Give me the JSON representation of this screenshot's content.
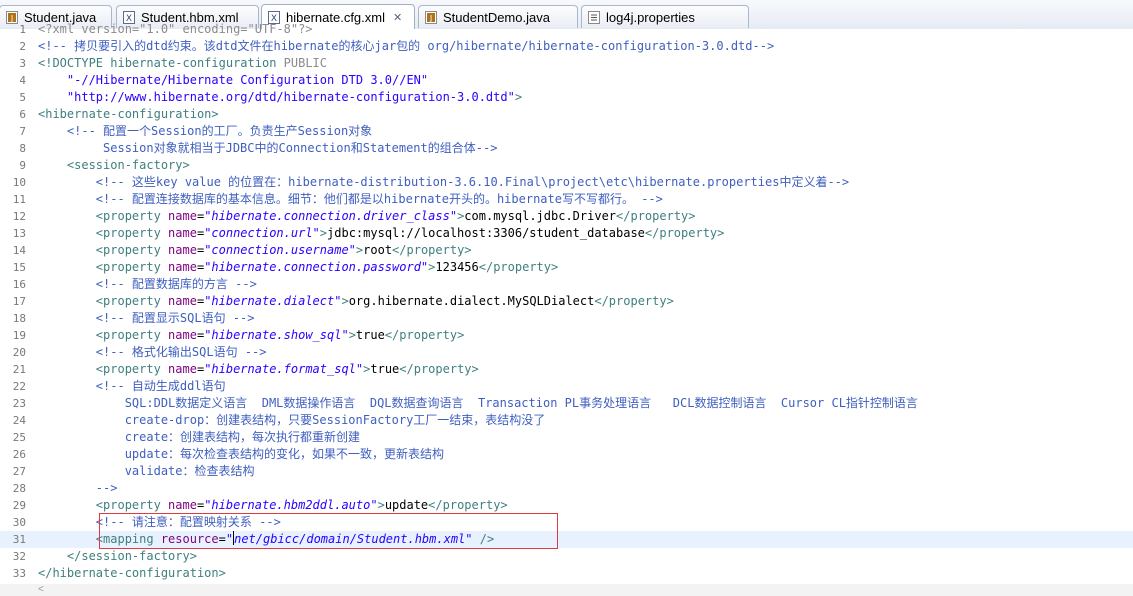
{
  "tabs": [
    {
      "label": "Student.java",
      "icon": "java-file-icon",
      "active": false
    },
    {
      "label": "Student.hbm.xml",
      "icon": "xml-file-icon",
      "active": false
    },
    {
      "label": "hibernate.cfg.xml",
      "icon": "xml-file-icon",
      "active": true,
      "close": "✕"
    },
    {
      "label": "StudentDemo.java",
      "icon": "java-file-icon",
      "active": false
    },
    {
      "label": "log4j.properties",
      "icon": "properties-file-icon",
      "active": false
    }
  ],
  "editor": {
    "current_line": 31,
    "lines": [
      {
        "n": "1",
        "segs": [
          {
            "t": "<?xml version=\"1.0\" encoding=\"UTF-8\"?>",
            "c": "pi"
          }
        ]
      },
      {
        "n": "2",
        "segs": [
          {
            "t": "<!-- 拷贝要引入的dtd约束。该dtd文件在hibernate的核心jar包的 org/hibernate/hibernate-configuration-3.0.dtd-->",
            "c": "com"
          }
        ]
      },
      {
        "n": "3",
        "segs": [
          {
            "t": "<!DOCTYPE hibernate-configuration ",
            "c": "tag"
          },
          {
            "t": "PUBLIC",
            "c": "pi"
          }
        ]
      },
      {
        "n": "4",
        "segs": [
          {
            "t": "    \"-//Hibernate/Hibernate Configuration DTD 3.0//EN\"",
            "c": "str"
          }
        ]
      },
      {
        "n": "5",
        "segs": [
          {
            "t": "    \"http://www.hibernate.org/dtd/hibernate-configuration-3.0.dtd\"",
            "c": "str"
          },
          {
            "t": ">",
            "c": "tag"
          }
        ]
      },
      {
        "n": "6",
        "segs": [
          {
            "t": "<hibernate-configuration>",
            "c": "tag"
          }
        ]
      },
      {
        "n": "7",
        "segs": [
          {
            "t": "    <!-- 配置一个Session的工厂。负责生产Session对象",
            "c": "com"
          }
        ]
      },
      {
        "n": "8",
        "segs": [
          {
            "t": "         Session对象就相当于JDBC中的Connection和Statement的组合体-->",
            "c": "com"
          }
        ]
      },
      {
        "n": "9",
        "segs": [
          {
            "t": "    <session-factory>",
            "c": "tag"
          }
        ]
      },
      {
        "n": "10",
        "segs": [
          {
            "t": "        <!-- 这些key value 的位置在：hibernate-distribution-3.6.10.Final\\project\\etc\\hibernate.properties中定义着-->",
            "c": "com"
          }
        ]
      },
      {
        "n": "11",
        "segs": [
          {
            "t": "        <!-- 配置连接数据库的基本信息。细节：他们都是以hibernate开头的。hibernate写不写都行。 -->",
            "c": "com"
          }
        ]
      },
      {
        "n": "12",
        "segs": [
          {
            "t": "        <property ",
            "c": "tag"
          },
          {
            "t": "name",
            "c": "att"
          },
          {
            "t": "=",
            "c": "txt"
          },
          {
            "t": "\"hibernate.connection.driver_class\"",
            "c": "val"
          },
          {
            "t": ">",
            "c": "tag"
          },
          {
            "t": "com.mysql.jdbc.Driver",
            "c": "txt"
          },
          {
            "t": "</property>",
            "c": "tag"
          }
        ]
      },
      {
        "n": "13",
        "segs": [
          {
            "t": "        <property ",
            "c": "tag"
          },
          {
            "t": "name",
            "c": "att"
          },
          {
            "t": "=",
            "c": "txt"
          },
          {
            "t": "\"connection.url\"",
            "c": "val"
          },
          {
            "t": ">",
            "c": "tag"
          },
          {
            "t": "jdbc:mysql://localhost:3306/student_database",
            "c": "txt"
          },
          {
            "t": "</property>",
            "c": "tag"
          }
        ]
      },
      {
        "n": "14",
        "segs": [
          {
            "t": "        <property ",
            "c": "tag"
          },
          {
            "t": "name",
            "c": "att"
          },
          {
            "t": "=",
            "c": "txt"
          },
          {
            "t": "\"connection.username\"",
            "c": "val"
          },
          {
            "t": ">",
            "c": "tag"
          },
          {
            "t": "root",
            "c": "txt"
          },
          {
            "t": "</property>",
            "c": "tag"
          }
        ]
      },
      {
        "n": "15",
        "segs": [
          {
            "t": "        <property ",
            "c": "tag"
          },
          {
            "t": "name",
            "c": "att"
          },
          {
            "t": "=",
            "c": "txt"
          },
          {
            "t": "\"hibernate.connection.password\"",
            "c": "val"
          },
          {
            "t": ">",
            "c": "tag"
          },
          {
            "t": "123456",
            "c": "txt"
          },
          {
            "t": "</property>",
            "c": "tag"
          }
        ]
      },
      {
        "n": "16",
        "segs": [
          {
            "t": "        <!-- 配置数据库的方言 -->",
            "c": "com"
          }
        ]
      },
      {
        "n": "17",
        "segs": [
          {
            "t": "        <property ",
            "c": "tag"
          },
          {
            "t": "name",
            "c": "att"
          },
          {
            "t": "=",
            "c": "txt"
          },
          {
            "t": "\"hibernate.dialect\"",
            "c": "val"
          },
          {
            "t": ">",
            "c": "tag"
          },
          {
            "t": "org.hibernate.dialect.MySQLDialect",
            "c": "txt"
          },
          {
            "t": "</property>",
            "c": "tag"
          }
        ]
      },
      {
        "n": "18",
        "segs": [
          {
            "t": "        <!-- 配置显示SQL语句 -->",
            "c": "com"
          }
        ]
      },
      {
        "n": "19",
        "segs": [
          {
            "t": "        <property ",
            "c": "tag"
          },
          {
            "t": "name",
            "c": "att"
          },
          {
            "t": "=",
            "c": "txt"
          },
          {
            "t": "\"hibernate.show_sql\"",
            "c": "val"
          },
          {
            "t": ">",
            "c": "tag"
          },
          {
            "t": "true",
            "c": "txt"
          },
          {
            "t": "</property>",
            "c": "tag"
          }
        ]
      },
      {
        "n": "20",
        "segs": [
          {
            "t": "        <!-- 格式化输出SQL语句 -->",
            "c": "com"
          }
        ]
      },
      {
        "n": "21",
        "segs": [
          {
            "t": "        <property ",
            "c": "tag"
          },
          {
            "t": "name",
            "c": "att"
          },
          {
            "t": "=",
            "c": "txt"
          },
          {
            "t": "\"hibernate.format_sql\"",
            "c": "val"
          },
          {
            "t": ">",
            "c": "tag"
          },
          {
            "t": "true",
            "c": "txt"
          },
          {
            "t": "</property>",
            "c": "tag"
          }
        ]
      },
      {
        "n": "22",
        "segs": [
          {
            "t": "        <!-- 自动生成ddl语句",
            "c": "com"
          }
        ]
      },
      {
        "n": "23",
        "segs": [
          {
            "t": "            SQL:DDL数据定义语言  DML数据操作语言  DQL数据查询语言  Transaction PL事务处理语言   DCL数据控制语言  Cursor CL指针控制语言",
            "c": "com"
          }
        ]
      },
      {
        "n": "24",
        "segs": [
          {
            "t": "            create-drop：创建表结构，只要SessionFactory工厂一结束，表结构没了",
            "c": "com"
          }
        ]
      },
      {
        "n": "25",
        "segs": [
          {
            "t": "            create：创建表结构，每次执行都重新创建",
            "c": "com"
          }
        ]
      },
      {
        "n": "26",
        "segs": [
          {
            "t": "            update：每次检查表结构的变化，如果不一致，更新表结构",
            "c": "com"
          }
        ]
      },
      {
        "n": "27",
        "segs": [
          {
            "t": "            validate：检查表结构",
            "c": "com"
          }
        ]
      },
      {
        "n": "28",
        "segs": [
          {
            "t": "        -->",
            "c": "com"
          }
        ]
      },
      {
        "n": "29",
        "segs": [
          {
            "t": "        <property ",
            "c": "tag"
          },
          {
            "t": "name",
            "c": "att"
          },
          {
            "t": "=",
            "c": "txt"
          },
          {
            "t": "\"hibernate.hbm2ddl.auto\"",
            "c": "val"
          },
          {
            "t": ">",
            "c": "tag"
          },
          {
            "t": "update",
            "c": "txt"
          },
          {
            "t": "</property>",
            "c": "tag"
          }
        ]
      },
      {
        "n": "30",
        "segs": [
          {
            "t": "        <!-- 请注意：配置映射关系 -->",
            "c": "com"
          }
        ]
      },
      {
        "n": "31",
        "segs": [
          {
            "t": "        <mapping ",
            "c": "tag"
          },
          {
            "t": "resource",
            "c": "att"
          },
          {
            "t": "=",
            "c": "txt"
          },
          {
            "t": "\"",
            "c": "val"
          },
          {
            "caret": true
          },
          {
            "t": "net/gbicc/domain/Student.hbm.xml\"",
            "c": "val"
          },
          {
            "t": " />",
            "c": "tag"
          }
        ]
      },
      {
        "n": "32",
        "segs": [
          {
            "t": "    </session-factory>",
            "c": "tag"
          }
        ]
      },
      {
        "n": "33",
        "segs": [
          {
            "t": "</hibernate-configuration>",
            "c": "tag"
          }
        ]
      }
    ]
  },
  "scrollbar": {
    "left_arrow": "<"
  }
}
